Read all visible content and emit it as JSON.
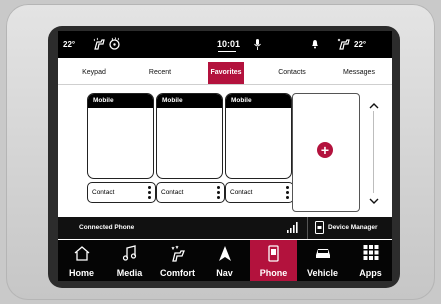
{
  "status": {
    "temp_left": "22°",
    "temp_right": "22°",
    "time": "10:01",
    "icons": [
      "seat-heat-icon",
      "steering-heat-icon",
      "mic-icon",
      "bell-icon",
      "seat-cool-icon"
    ]
  },
  "tabs": [
    {
      "label": "Keypad",
      "active": false
    },
    {
      "label": "Recent",
      "active": false
    },
    {
      "label": "Favorites",
      "active": true
    },
    {
      "label": "Contacts",
      "active": false
    },
    {
      "label": "Messages",
      "active": false
    }
  ],
  "favorites": [
    {
      "type": "Mobile",
      "contact": "Contact"
    },
    {
      "type": "Mobile",
      "contact": "Contact"
    },
    {
      "type": "Mobile",
      "contact": "Contact"
    }
  ],
  "add_favorite_icon": "plus-circle-icon",
  "phone_bar": {
    "connected": "Connected Phone",
    "signal_icon": "signal-bars-icon",
    "device_manager": "Device Manager",
    "device_icon": "phone-device-icon"
  },
  "nav": [
    {
      "label": "Home",
      "icon": "home-icon",
      "active": false
    },
    {
      "label": "Media",
      "icon": "music-note-icon",
      "active": false
    },
    {
      "label": "Comfort",
      "icon": "seat-fan-icon",
      "active": false
    },
    {
      "label": "Nav",
      "icon": "navigation-arrow-icon",
      "active": false
    },
    {
      "label": "Phone",
      "icon": "phone-icon",
      "active": true
    },
    {
      "label": "Vehicle",
      "icon": "car-icon",
      "active": false
    },
    {
      "label": "Apps",
      "icon": "apps-grid-icon",
      "active": false
    }
  ],
  "colors": {
    "accent": "#b3123d",
    "bar": "#000000"
  }
}
